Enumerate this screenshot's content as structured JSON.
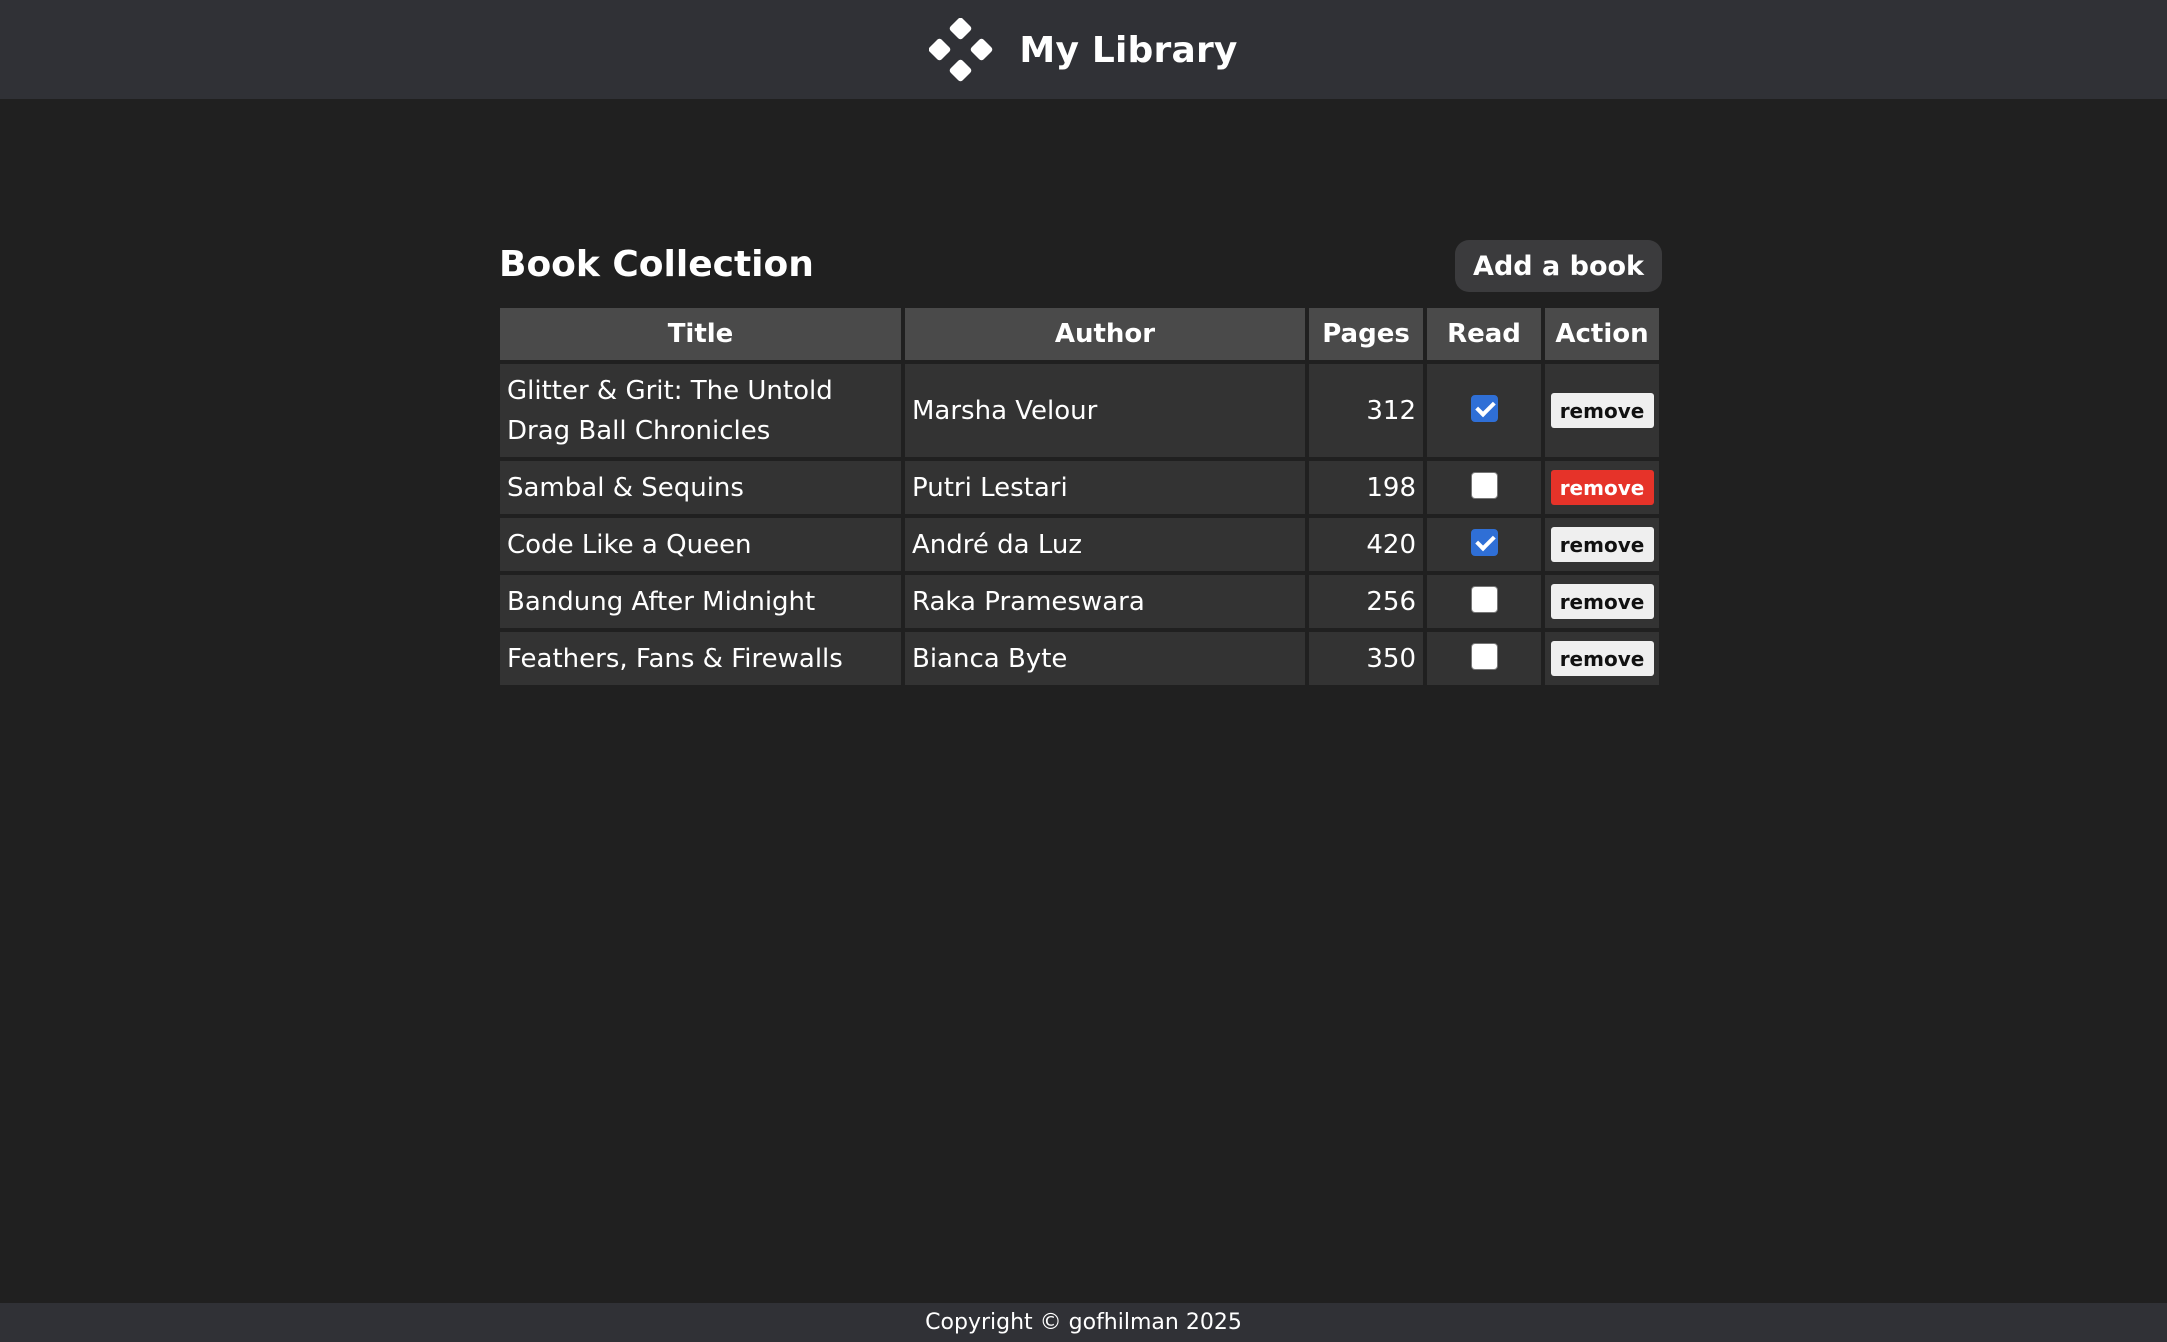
{
  "header": {
    "logo_icon": "four-diamond-logo-icon",
    "title": "My Library"
  },
  "main": {
    "heading": "Book Collection",
    "add_button_label": "Add a book"
  },
  "table": {
    "columns": [
      "Title",
      "Author",
      "Pages",
      "Read",
      "Action"
    ],
    "rows": [
      {
        "title": "Glitter & Grit: The Untold Drag Ball Chronicles",
        "author": "Marsha Velour",
        "pages": "312",
        "read": true,
        "action": "remove",
        "action_state": "default"
      },
      {
        "title": "Sambal & Sequins",
        "author": "Putri Lestari",
        "pages": "198",
        "read": false,
        "action": "remove",
        "action_state": "hover"
      },
      {
        "title": "Code Like a Queen",
        "author": "André da Luz",
        "pages": "420",
        "read": true,
        "action": "remove",
        "action_state": "default"
      },
      {
        "title": "Bandung After Midnight",
        "author": "Raka Prameswara",
        "pages": "256",
        "read": false,
        "action": "remove",
        "action_state": "default"
      },
      {
        "title": "Feathers, Fans & Firewalls",
        "author": "Bianca Byte",
        "pages": "350",
        "read": false,
        "action": "remove",
        "action_state": "default"
      }
    ]
  },
  "footer": {
    "copyright": "Copyright © gofhilman 2025"
  },
  "colors": {
    "background": "#202020",
    "header_bg": "#303136",
    "checkbox_checked": "#2f6fd6",
    "remove_hover": "#e63329"
  }
}
